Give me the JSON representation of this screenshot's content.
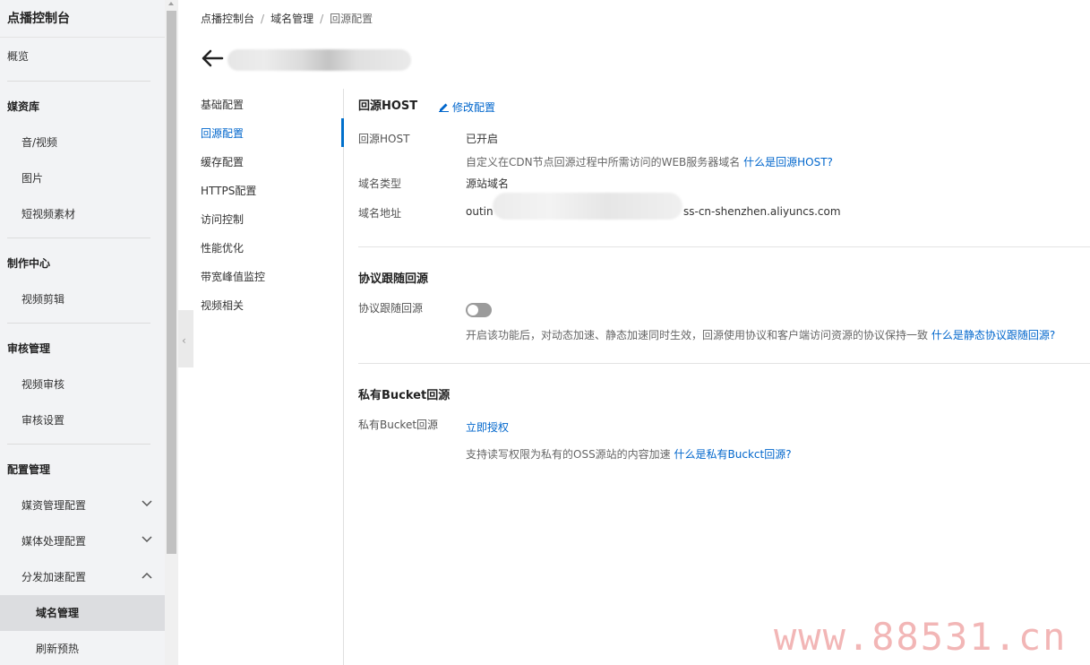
{
  "sidebar": {
    "title": "点播控制台",
    "overview": "概览",
    "groups": {
      "media": "媒资库",
      "production": "制作中心",
      "review": "审核管理",
      "config": "配置管理"
    },
    "media_items": [
      "音/视频",
      "图片",
      "短视频素材"
    ],
    "production_items": [
      "视频剪辑"
    ],
    "review_items": [
      "视频审核",
      "审核设置"
    ],
    "config_items": [
      "媒资管理配置",
      "媒体处理配置",
      "分发加速配置"
    ],
    "config_sub_items": [
      "域名管理",
      "刷新预热"
    ]
  },
  "breadcrumb": [
    "点播控制台",
    "域名管理",
    "回源配置"
  ],
  "breadcrumb_sep": "/",
  "subnav": [
    "基础配置",
    "回源配置",
    "缓存配置",
    "HTTPS配置",
    "访问控制",
    "性能优化",
    "带宽峰值监控",
    "视频相关"
  ],
  "active_subnav": "回源配置",
  "origin_host": {
    "title": "回源HOST",
    "edit": "修改配置",
    "label_status": "回源HOST",
    "status": "已开启",
    "desc": "自定义在CDN节点回源过程中所需访问的WEB服务器域名",
    "desc_link": "什么是回源HOST?",
    "label_type": "域名类型",
    "type": "源站域名",
    "label_addr": "域名地址",
    "addr_prefix": "outin",
    "addr_suffix": "ss-cn-shenzhen.aliyuncs.com"
  },
  "protocol": {
    "title": "协议跟随回源",
    "label": "协议跟随回源",
    "enabled": false,
    "desc": "开启该功能后，对动态加速、静态加速同时生效，回源使用协议和客户端访问资源的协议保持一致",
    "desc_link": "什么是静态协议跟随回源?"
  },
  "bucket": {
    "title": "私有Bucket回源",
    "label": "私有Bucket回源",
    "action": "立即授权",
    "desc": "支持读写权限为私有的OSS源站的内容加速",
    "desc_link": "什么是私有Buckct回源?"
  },
  "watermark": "www.88531.cn",
  "colors": {
    "accent": "#0066cc",
    "sidebar_bg": "#f2f3f5",
    "toggle_off": "#9b9b9b"
  }
}
